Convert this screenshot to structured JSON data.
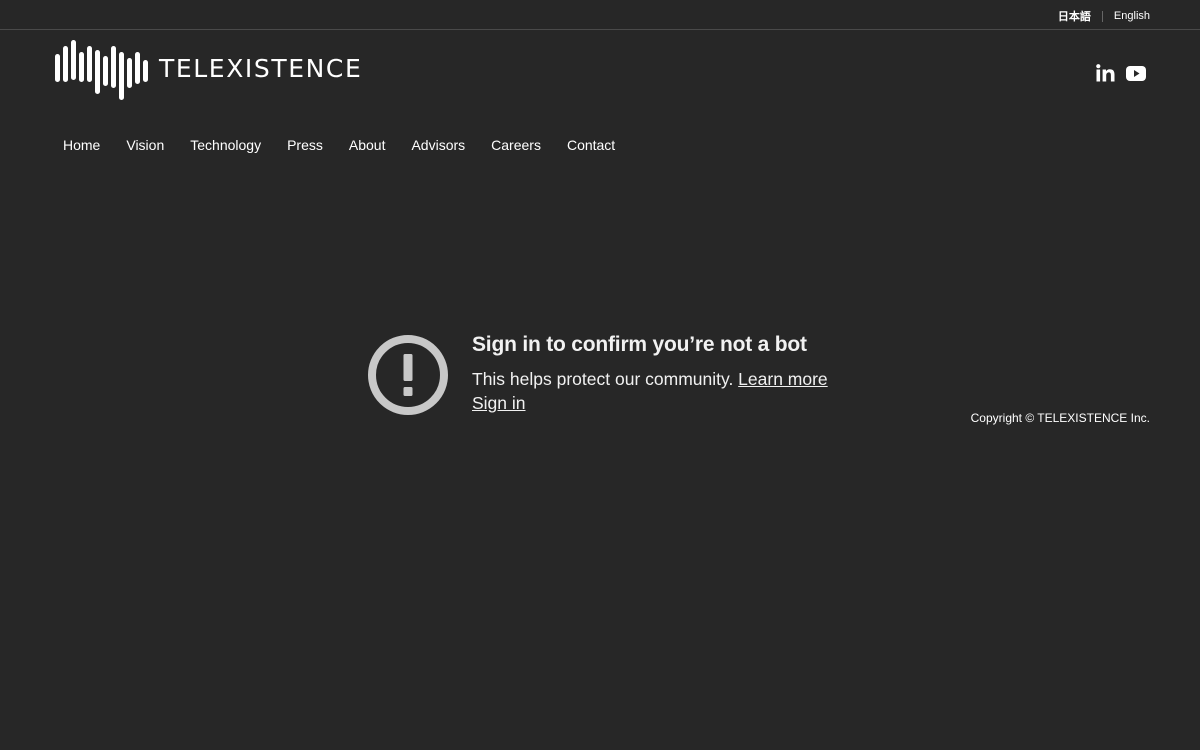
{
  "language_bar": {
    "japanese_label": "日本語",
    "english_label": "English"
  },
  "header": {
    "logo_text": "TELEXISTENCE",
    "social": [
      {
        "icon": "linkedin-icon",
        "label": "in"
      },
      {
        "icon": "youtube-icon"
      }
    ]
  },
  "nav": {
    "items": [
      {
        "label": "Home"
      },
      {
        "label": "Vision"
      },
      {
        "label": "Technology"
      },
      {
        "label": "Press"
      },
      {
        "label": "About"
      },
      {
        "label": "Advisors"
      },
      {
        "label": "Careers"
      },
      {
        "label": "Contact"
      }
    ]
  },
  "bot_check": {
    "icon": "exclamation-circle-icon",
    "title": "Sign in to confirm you’re not a bot",
    "message": "This helps protect our community.",
    "learn_more_label": "Learn more",
    "sign_in_label": "Sign in"
  },
  "footer": {
    "copyright": "Copyright © TELEXISTENCE Inc."
  },
  "colors": {
    "background": "#272727",
    "text": "#ffffff",
    "icon_gray": "#c8c8c8"
  }
}
